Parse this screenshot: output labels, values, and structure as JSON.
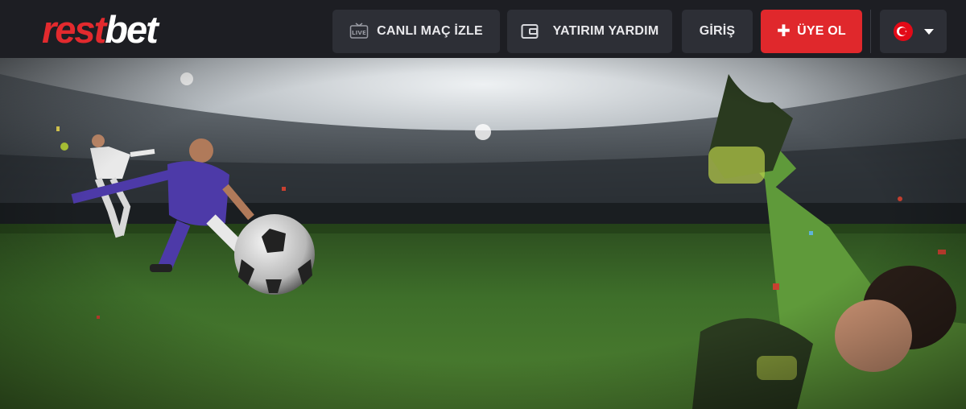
{
  "logo": {
    "part1": "rest",
    "part2": "bet"
  },
  "nav": {
    "live_match": {
      "label": "CANLI MAÇ İZLE",
      "icon": "live-tv-icon"
    },
    "deposit_help": {
      "label": "YATIRIM YARDIM",
      "icon": "wallet-icon"
    },
    "login": {
      "label": "GİRİŞ"
    },
    "register": {
      "label": "ÜYE OL",
      "icon": "plus-icon"
    },
    "language": {
      "flag": "turkey-flag-icon",
      "icon": "caret-down-icon"
    }
  },
  "colors": {
    "brand_red": "#e0282c",
    "topbar": "#1d1e23",
    "button": "#2d2f36"
  },
  "hero": {
    "scene": "stadium-football-banner"
  }
}
